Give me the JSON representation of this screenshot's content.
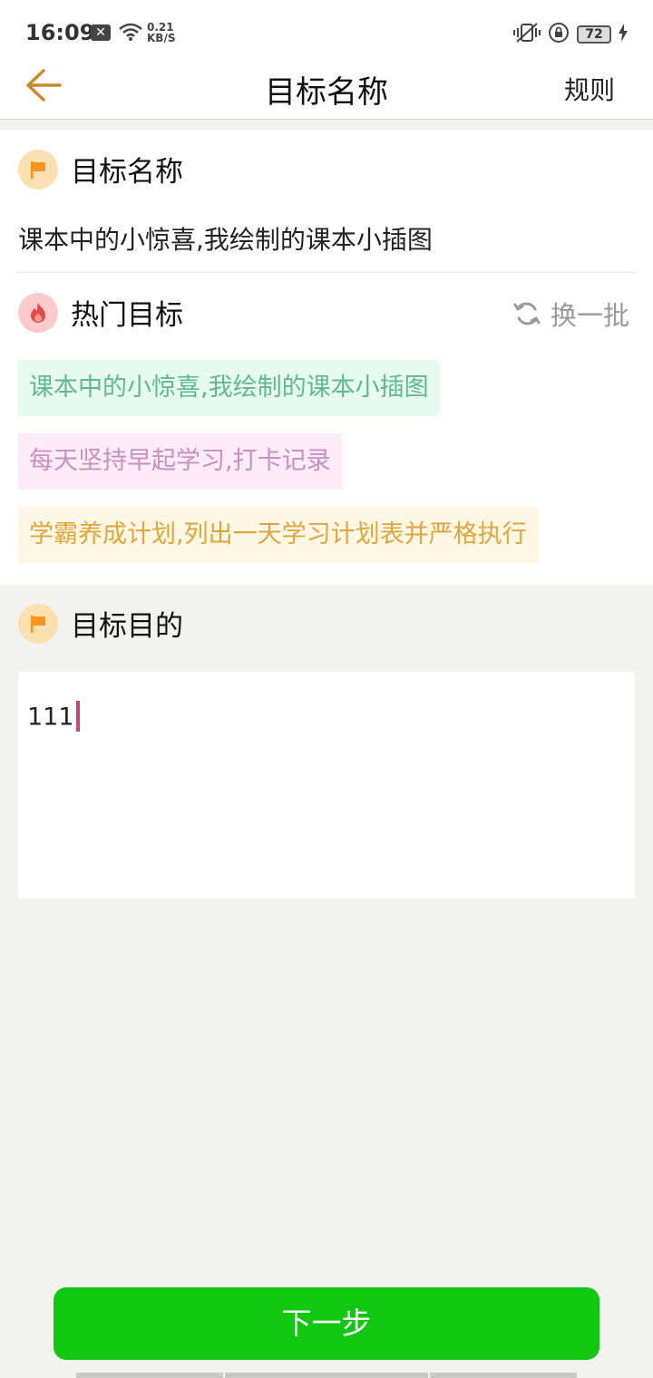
{
  "status": {
    "time": "16:09",
    "notification_icon": "close-box-icon",
    "speed_value": "0.21",
    "speed_unit": "KB/S",
    "battery": "72"
  },
  "nav": {
    "title": "目标名称",
    "rules_label": "规则"
  },
  "goal_name": {
    "section_title": "目标名称",
    "value": "课本中的小惊喜,我绘制的课本小插图"
  },
  "hot_goals": {
    "section_title": "热门目标",
    "refresh_label": "换一批",
    "items": [
      {
        "label": "课本中的小惊喜,我绘制的课本小插图",
        "text_color": "#5fb996",
        "bg_color": "#e6faf0"
      },
      {
        "label": "每天坚持早起学习,打卡记录",
        "text_color": "#c890bf",
        "bg_color": "#fdecf8"
      },
      {
        "label": "学霸养成计划,列出一天学习计划表并严格执行",
        "text_color": "#e0a63a",
        "bg_color": "#fff7e4"
      }
    ]
  },
  "purpose": {
    "section_title": "目标目的",
    "value": "111"
  },
  "footer": {
    "next_label": "下一步"
  },
  "colors": {
    "accent_green": "#10c810",
    "back_arrow": "#c88b2a",
    "flag_orange": "#f7941d"
  }
}
